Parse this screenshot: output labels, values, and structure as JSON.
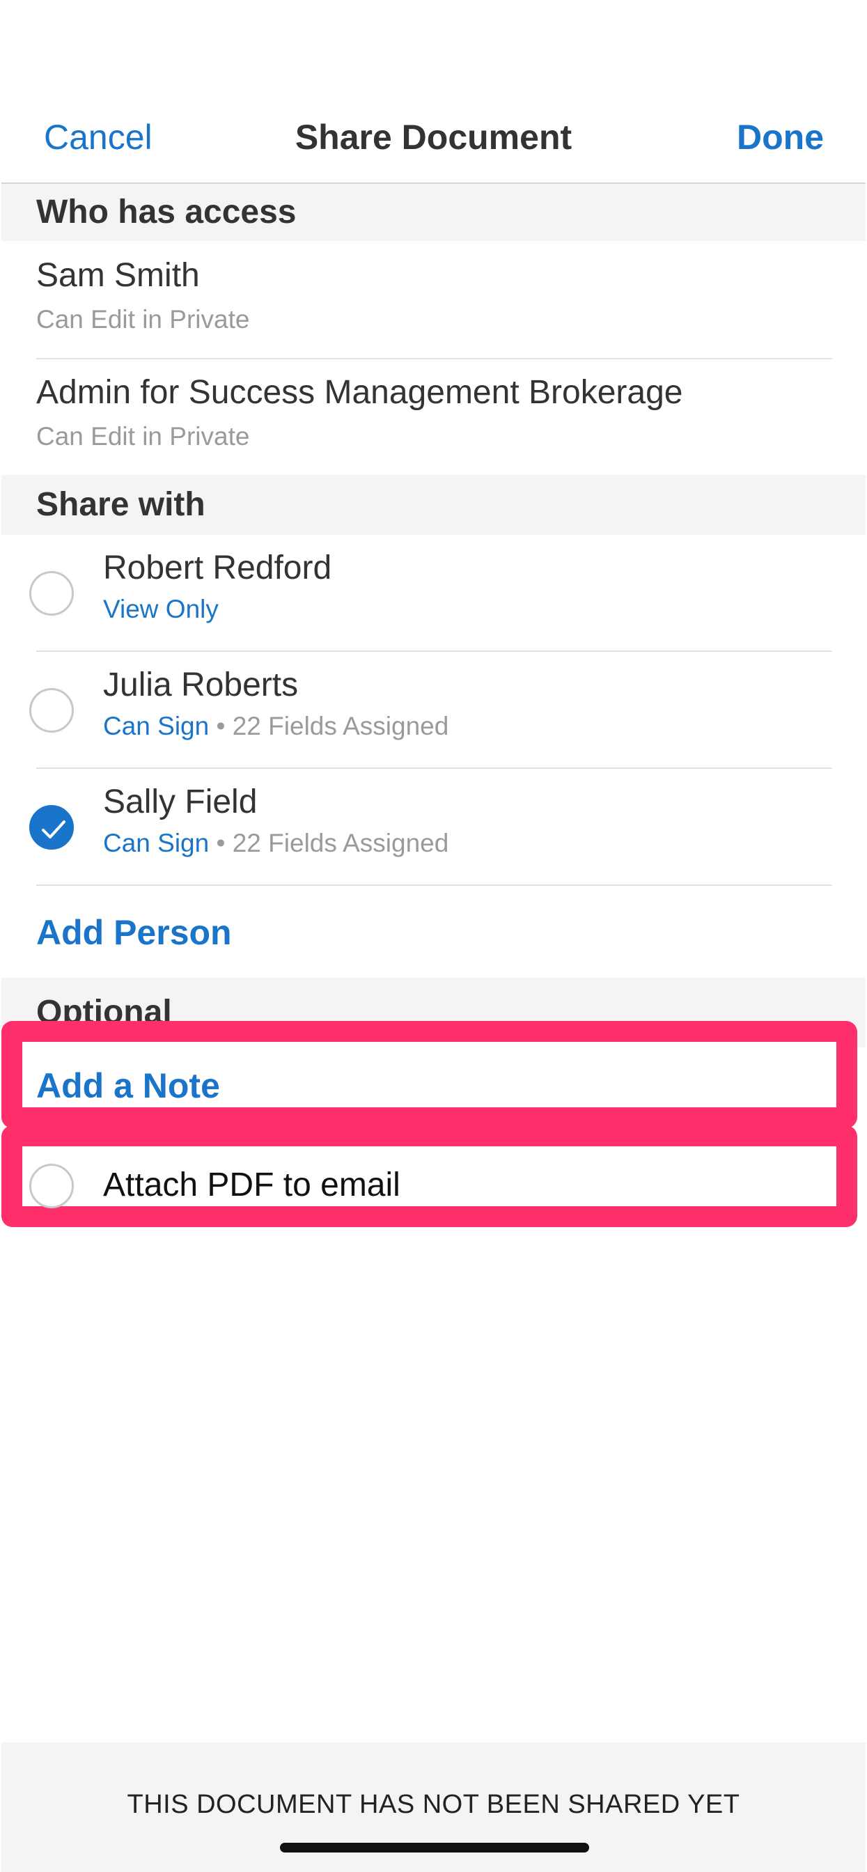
{
  "nav": {
    "cancel_label": "Cancel",
    "title": "Share Document",
    "done_label": "Done"
  },
  "access": {
    "header": "Who has access",
    "items": [
      {
        "name": "Sam Smith",
        "permission": "Can Edit in Private"
      },
      {
        "name": "Admin for Success Management Brokerage",
        "permission": "Can Edit in Private"
      }
    ]
  },
  "share": {
    "header": "Share with",
    "items": [
      {
        "name": "Robert Redford",
        "role": "View Only",
        "separator": "",
        "fields": "",
        "checked": false
      },
      {
        "name": "Julia Roberts",
        "role": "Can Sign",
        "separator": " • ",
        "fields": "22 Fields Assigned",
        "checked": false
      },
      {
        "name": "Sally Field",
        "role": "Can Sign",
        "separator": " • ",
        "fields": "22 Fields Assigned",
        "checked": true
      }
    ],
    "add_person_label": "Add Person"
  },
  "optional": {
    "header": "Optional",
    "add_note_label": "Add a Note",
    "attach_pdf_label": "Attach PDF to email",
    "attach_pdf_checked": false
  },
  "footer": {
    "status_text": "THIS DOCUMENT HAS NOT BEEN SHARED YET"
  },
  "colors": {
    "accent": "#1a74c9",
    "highlight": "#ff2f6b",
    "section_bg": "#f4f4f4",
    "muted_text": "#9a9a9a"
  }
}
